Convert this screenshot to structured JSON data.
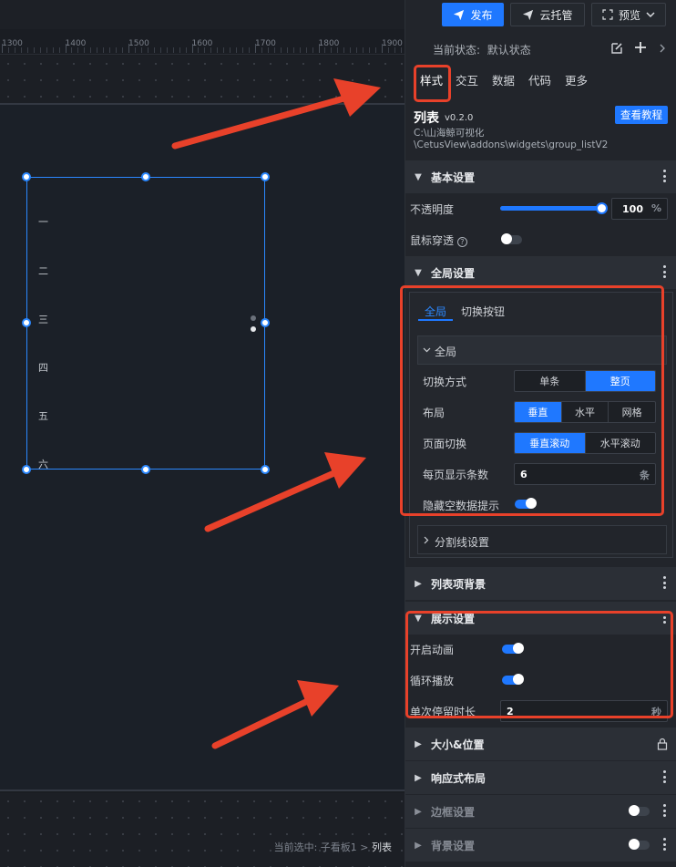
{
  "toolbar": {
    "publish": "发布",
    "cloud": "云托管",
    "preview": "预览"
  },
  "ruler": {
    "labels": [
      "1300",
      "1400",
      "1500",
      "1600",
      "1700",
      "1800",
      "1900"
    ]
  },
  "canvas_list": [
    "一",
    "二",
    "三",
    "四",
    "五",
    "六"
  ],
  "status_bar": {
    "prefix": "当前选中: 子看板1 > ",
    "current": "列表"
  },
  "panel": {
    "state_label": "当前状态:",
    "state_value": "默认状态",
    "tabs": [
      "样式",
      "交互",
      "数据",
      "代码",
      "更多"
    ],
    "component": {
      "name": "列表",
      "version": "v0.2.0",
      "path": "C:\\山海鲸可视化\n\\CetusView\\addons\\widgets\\group_listV2",
      "tutorial": "查看教程"
    },
    "basic": {
      "title": "基本设置",
      "opacity_label": "不透明度",
      "opacity_value": "100",
      "opacity_unit": "%",
      "opacity": 1.0,
      "mouse_label": "鼠标穿透"
    },
    "global": {
      "title": "全局设置",
      "subtabs": [
        "全局",
        "切换按钮"
      ],
      "group_title": "全局",
      "switch_mode_label": "切换方式",
      "switch_mode_options": [
        "单条",
        "整页"
      ],
      "layout_label": "布局",
      "layout_options": [
        "垂直",
        "水平",
        "网格"
      ],
      "page_switch_label": "页面切换",
      "page_switch_options": [
        "垂直滚动",
        "水平滚动"
      ],
      "per_page_label": "每页显示条数",
      "per_page_value": "6",
      "per_page_unit": "条",
      "hide_empty_label": "隐藏空数据提示",
      "divider_title": "分割线设置"
    },
    "list_bg": {
      "title": "列表项背景"
    },
    "display": {
      "title": "展示设置",
      "anim_label": "开启动画",
      "loop_label": "循环播放",
      "stay_label": "单次停留时长",
      "stay_value": "2",
      "stay_unit": "秒"
    },
    "size_pos": {
      "title": "大小&位置"
    },
    "responsive": {
      "title": "响应式布局"
    },
    "border": {
      "title": "边框设置"
    },
    "background": {
      "title": "背景设置"
    }
  },
  "colors": {
    "accent": "#1f78ff",
    "annotation": "#e8412a"
  }
}
